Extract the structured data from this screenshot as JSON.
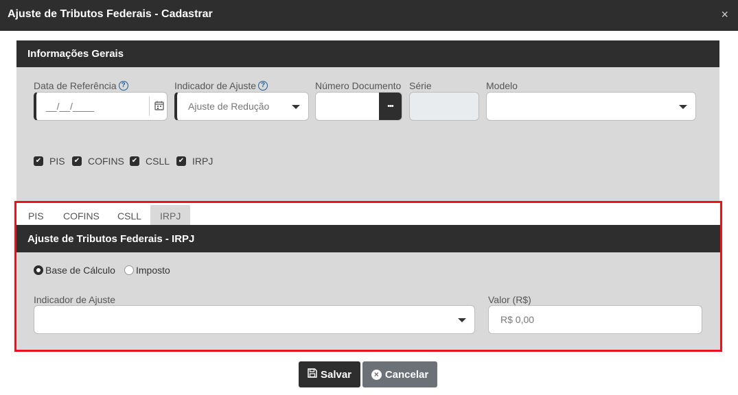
{
  "window": {
    "title": "Ajuste de Tributos Federais - Cadastrar",
    "close": "×"
  },
  "general": {
    "header": "Informações Gerais",
    "data_referencia": {
      "label": "Data de Referência",
      "value": "__/__/____"
    },
    "indicador_ajuste": {
      "label": "Indicador de Ajuste",
      "value": "Ajuste de Redução"
    },
    "numero_documento": {
      "label": "Número Documento",
      "value": "",
      "button": "•••"
    },
    "serie": {
      "label": "Série",
      "value": ""
    },
    "modelo": {
      "label": "Modelo",
      "value": ""
    },
    "checkboxes": [
      {
        "label": "PIS",
        "checked": true
      },
      {
        "label": "COFINS",
        "checked": true
      },
      {
        "label": "CSLL",
        "checked": true
      },
      {
        "label": "IRPJ",
        "checked": true
      }
    ]
  },
  "tabs": [
    {
      "label": "PIS",
      "active": false
    },
    {
      "label": "COFINS",
      "active": false
    },
    {
      "label": "CSLL",
      "active": false
    },
    {
      "label": "IRPJ",
      "active": true
    }
  ],
  "irpj": {
    "header": "Ajuste de Tributos Federais - IRPJ",
    "radios": [
      {
        "label": "Base de Cálculo",
        "selected": true
      },
      {
        "label": "Imposto",
        "selected": false
      }
    ],
    "indicador_ajuste": {
      "label": "Indicador de Ajuste",
      "value": ""
    },
    "valor": {
      "label": "Valor (R$)",
      "placeholder": "R$ 0,00"
    }
  },
  "buttons": {
    "save": "Salvar",
    "cancel": "Cancelar"
  },
  "colors": {
    "dark": "#2e2e2e",
    "panel": "#d9d9d9",
    "highlight": "#e8141c",
    "cancel": "#6c7177"
  },
  "icons": [
    "help-icon",
    "calendar-icon",
    "ellipsis-icon",
    "caret-down-icon",
    "check-icon",
    "save-icon",
    "cancel-icon",
    "close-icon"
  ]
}
